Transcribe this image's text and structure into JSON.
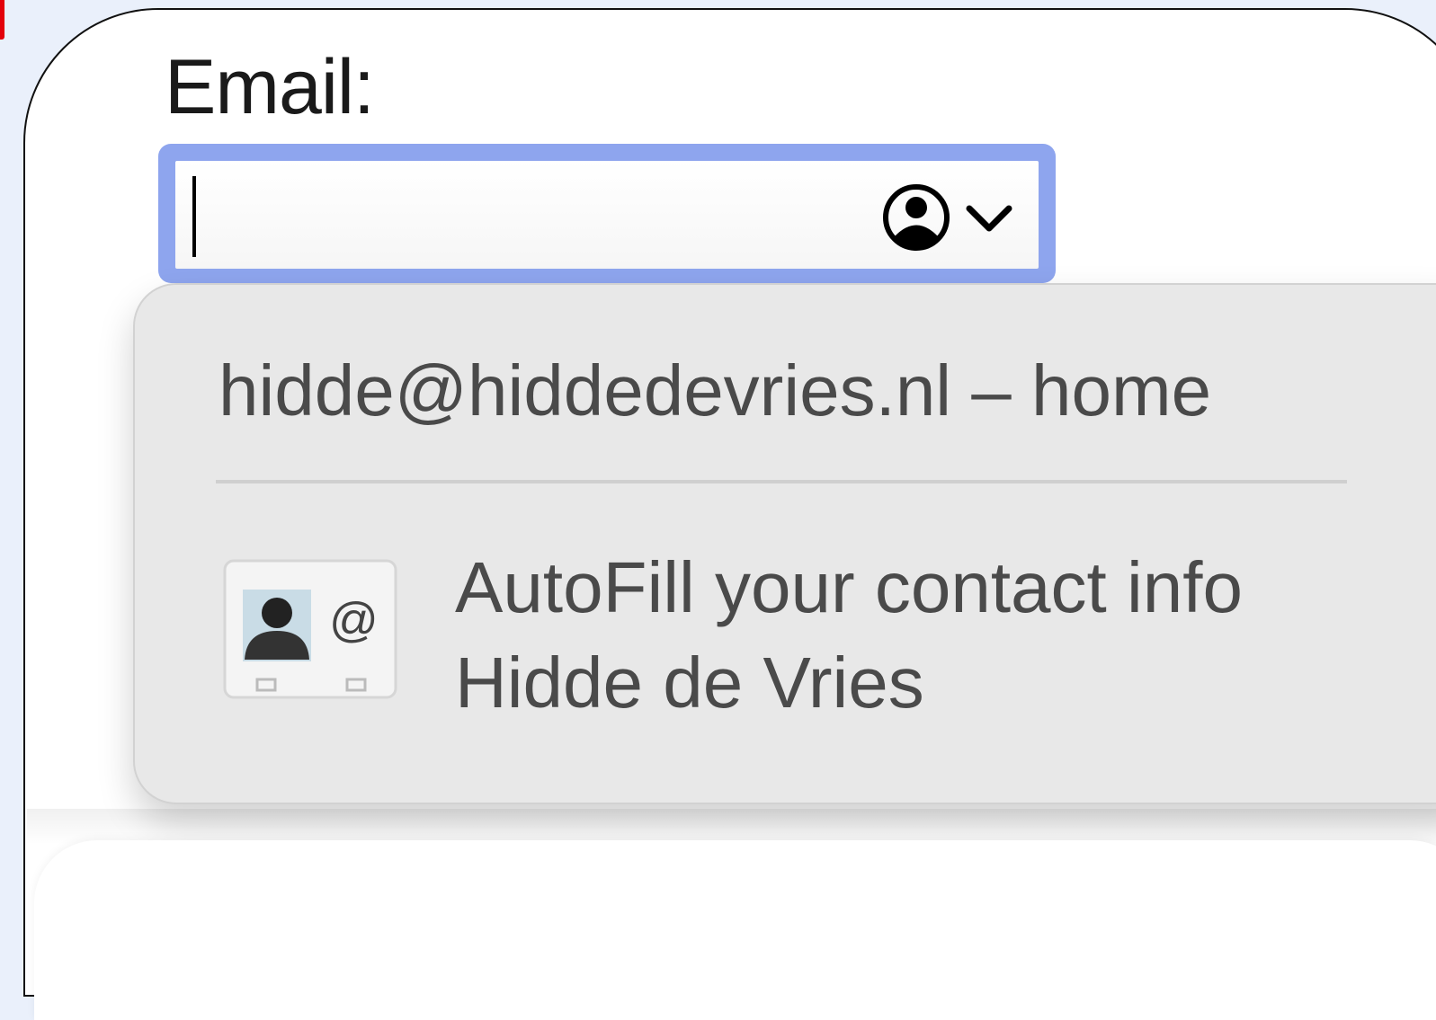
{
  "form": {
    "email_label": "Email:",
    "email_value": ""
  },
  "autofill_menu": {
    "suggestion": "hidde@hiddedevries.nl – home",
    "autofill_title": "AutoFill your contact info",
    "autofill_name": "Hidde de Vries",
    "icon": "contact-card-icon"
  },
  "field_icon": "contact-autofill-icon",
  "colors": {
    "focus_ring": "#8ea5ee",
    "menu_bg": "#e8e8e8",
    "menu_text": "#4a4a4a",
    "page_bg": "#eaf0fb",
    "marker": "#e3000b"
  }
}
